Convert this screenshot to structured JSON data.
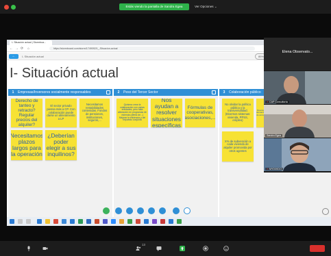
{
  "zoom": {
    "share_banner": "Estás viendo la pantalla de Sandra Egea",
    "view_options": "Ver Opciones",
    "participant_count": "13"
  },
  "browser": {
    "tab_title": "I- Situación actual | Stormboa...",
    "url": "https://stormboard.com/storm/1749092/1_-Situacion-actual"
  },
  "app": {
    "breadcrumb": "I- Situación actual",
    "zoom_level": "85%",
    "board_title": "I- Situación actual"
  },
  "columns": [
    {
      "number": "1",
      "title": "Empresas/Inversores socialmente responsables",
      "notes": [
        "Derecho de tanteo y retracto? Regular precios del alquiler?",
        "El sector privado piensa más a CP. Con colaboración puede darse un alineamiento a LP",
        "Necesitamos rentabilidades contenidas. Fondos de pensiones, instituciones, seguros,...",
        "Necesitamos plazos largos para la operación",
        "¿Deberían poder elegir a sus inquilinos?"
      ]
    },
    {
      "number": "2",
      "title": "Peso del Tercer Sector",
      "notes": [
        "Quisiera crear la colaboración con varias entidades, pero falta alineación en programas de vivienda (oferta de...) Mejorar la eficiencia y del impuesto conjunta",
        "Nos ayudan a resolver situaciones específicas",
        "Fórmulas de cooperativas, asociaciones,..."
      ]
    },
    {
      "number": "3",
      "title": "Colaboración público",
      "notes": [
        "No olvidar la política pública y la transversalidad. (Diversos sistemas: vivienda, PPSS, empleo)",
        "Resolver demandas de acceso",
        "X% de subvención a cada vivienda de alquiler promovida por otros agentes"
      ]
    }
  ],
  "participants": [
    {
      "name": "Elena Observato..."
    },
    {
      "name": "CAP Consultoría"
    },
    {
      "name": "Sandra Egea"
    },
    {
      "name": "MYDIXIDO"
    }
  ],
  "colors": {
    "header_blue": "#2f8fd6",
    "sticky_yellow": "#f7e234",
    "sticky_text": "#2a5fa8",
    "share_green": "#2eb24a",
    "end_red": "#d9302c"
  }
}
